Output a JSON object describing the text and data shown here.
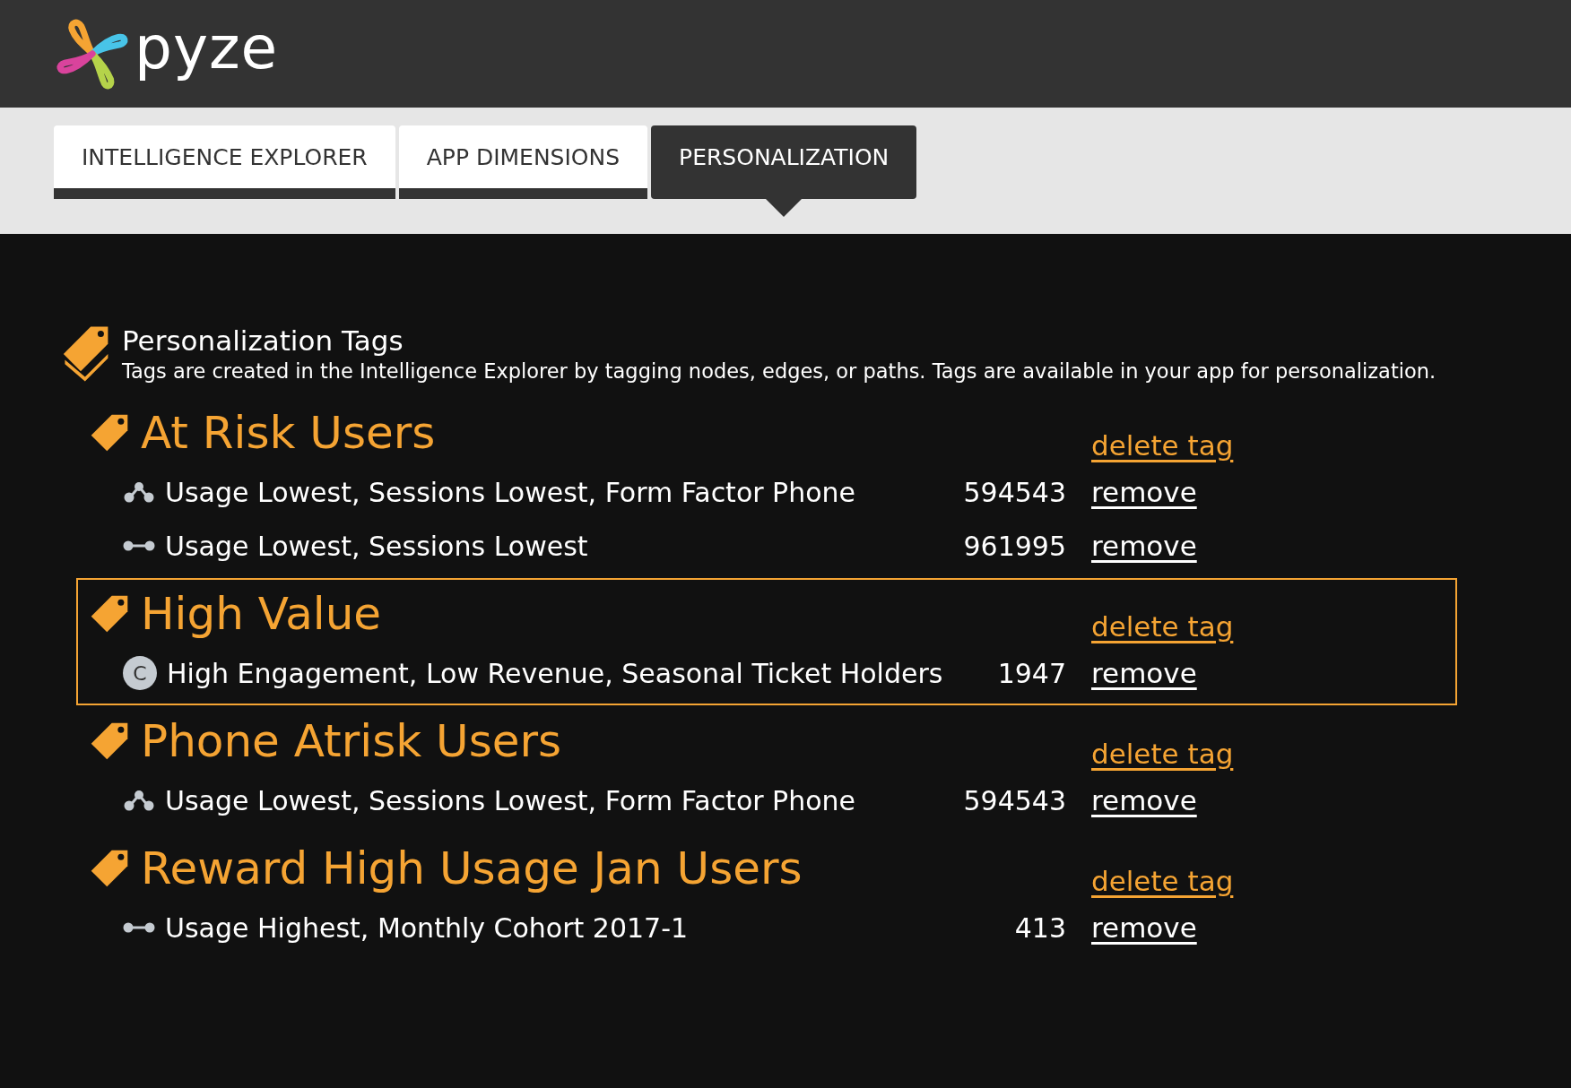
{
  "logo": {
    "text": "pyze"
  },
  "tabs": [
    {
      "label": "INTELLIGENCE EXPLORER",
      "selected": false
    },
    {
      "label": "APP DIMENSIONS",
      "selected": false
    },
    {
      "label": "PERSONALIZATION",
      "selected": true
    }
  ],
  "section": {
    "title": "Personalization Tags",
    "description": "Tags are created in the Intelligence Explorer by tagging nodes, edges, or paths. Tags are available in your app for personalization."
  },
  "tags": [
    {
      "name": "At Risk Users",
      "selected": false,
      "delete_label": "delete tag",
      "items": [
        {
          "kind": "path",
          "label": "Usage Lowest, Sessions Lowest, Form Factor Phone",
          "count": "594543",
          "action": "remove"
        },
        {
          "kind": "edge",
          "label": "Usage Lowest, Sessions Lowest",
          "count": "961995",
          "action": "remove"
        }
      ]
    },
    {
      "name": "High Value",
      "selected": true,
      "delete_label": "delete tag",
      "items": [
        {
          "kind": "cohort",
          "badge": "C",
          "label": "High Engagement, Low Revenue, Seasonal Ticket Holders",
          "count": "1947",
          "action": "remove"
        }
      ]
    },
    {
      "name": "Phone Atrisk Users",
      "selected": false,
      "delete_label": "delete tag",
      "items": [
        {
          "kind": "path",
          "label": "Usage Lowest, Sessions Lowest, Form Factor Phone",
          "count": "594543",
          "action": "remove"
        }
      ]
    },
    {
      "name": "Reward High Usage Jan Users",
      "selected": false,
      "delete_label": "delete tag",
      "items": [
        {
          "kind": "edge",
          "label": "Usage Highest, Monthly Cohort 2017-1",
          "count": "413",
          "action": "remove"
        }
      ]
    }
  ]
}
